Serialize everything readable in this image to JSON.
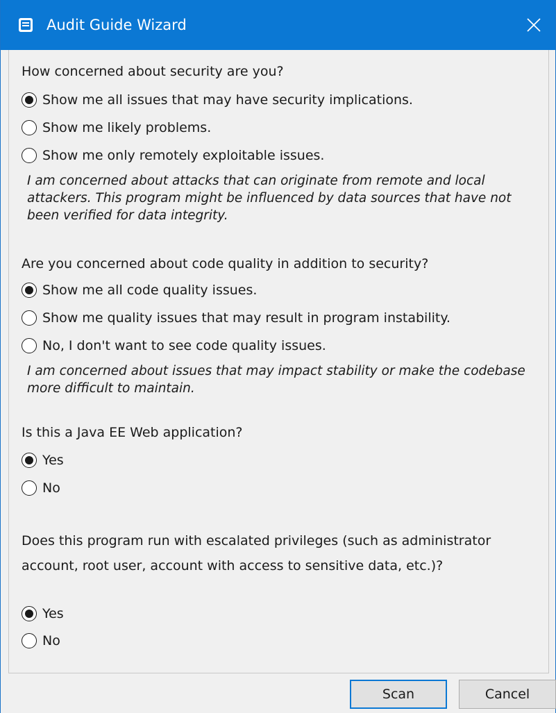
{
  "window": {
    "title": "Audit Guide Wizard",
    "accent_color": "#0b78d4"
  },
  "questions": [
    {
      "label": "How concerned about security are you?",
      "options": [
        {
          "label": "Show me all issues that may have security implications.",
          "selected": true
        },
        {
          "label": "Show me likely problems.",
          "selected": false
        },
        {
          "label": "Show me only remotely exploitable issues.",
          "selected": false
        }
      ],
      "description": "I am concerned about attacks that can originate from remote and local attackers. This program might be influenced by data sources that have not been verified for data integrity."
    },
    {
      "label": "Are you concerned about code quality in addition to security?",
      "options": [
        {
          "label": "Show me all code quality issues.",
          "selected": true
        },
        {
          "label": "Show me quality issues that may result in program instability.",
          "selected": false
        },
        {
          "label": "No, I don't want to see code quality issues.",
          "selected": false
        }
      ],
      "description": "I am concerned about issues that may impact stability or make the codebase more difficult to maintain."
    },
    {
      "label": "Is this a Java EE Web application?",
      "options": [
        {
          "label": "Yes",
          "selected": true
        },
        {
          "label": "No",
          "selected": false
        }
      ]
    },
    {
      "label": "Does this program run with escalated privileges (such as administrator account, root user, account with access to sensitive data, etc.)?",
      "options": [
        {
          "label": "Yes",
          "selected": true
        },
        {
          "label": "No",
          "selected": false
        }
      ]
    }
  ],
  "buttons": {
    "scan": "Scan",
    "cancel": "Cancel"
  },
  "icons": {
    "app": "app-window-icon",
    "close": "close-icon"
  }
}
